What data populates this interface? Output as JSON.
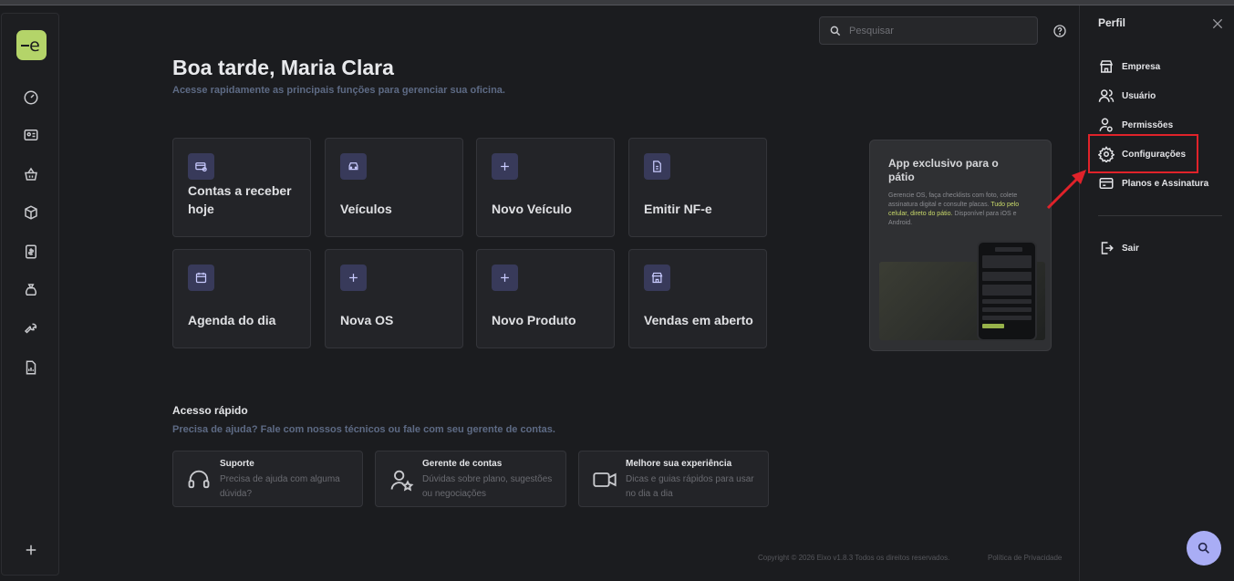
{
  "sidebar": {
    "logo_letter": "e",
    "items": [
      {
        "name": "dashboard-icon"
      },
      {
        "name": "id-card-icon"
      },
      {
        "name": "basket-icon"
      },
      {
        "name": "box-icon"
      },
      {
        "name": "receipt-icon"
      },
      {
        "name": "money-bag-icon"
      },
      {
        "name": "wrench-icon"
      },
      {
        "name": "report-icon"
      }
    ],
    "add_icon": "plus-icon"
  },
  "header": {
    "search_placeholder": "Pesquisar"
  },
  "home": {
    "greeting": "Boa tarde, Maria Clara",
    "subtitle": "Acesse rapidamente as principais funções para gerenciar sua oficina.",
    "cards": [
      {
        "label": "Contas a receber hoje",
        "icon": "money-card-icon"
      },
      {
        "label": "Veículos",
        "icon": "car-icon"
      },
      {
        "label": "Novo Veículo",
        "icon": "plus-icon"
      },
      {
        "label": "Emitir NF-e",
        "icon": "invoice-icon"
      },
      {
        "label": "Agenda do dia",
        "icon": "calendar-icon"
      },
      {
        "label": "Nova OS",
        "icon": "plus-icon"
      },
      {
        "label": "Novo Produto",
        "icon": "plus-icon"
      },
      {
        "label": "Vendas em aberto",
        "icon": "store-icon"
      }
    ],
    "promo": {
      "title": "App exclusivo para o pátio",
      "body_start": "Gerencie OS, faça checklists com foto, colete assinatura digital e consulte placas. ",
      "body_highlight": "Tudo pelo celular, direto do pátio.",
      "body_end": " Disponível para iOS e Android."
    },
    "quick_access": {
      "title": "Acesso rápido",
      "subtitle": "Precisa de ajuda? Fale com nossos técnicos ou fale com seu gerente de contas.",
      "items": [
        {
          "title": "Suporte",
          "desc": "Precisa de ajuda com alguma dúvida?",
          "icon": "headset-icon"
        },
        {
          "title": "Gerente de contas",
          "desc": "Dúvidas sobre plano, sugestões ou negociações",
          "icon": "user-star-icon"
        },
        {
          "title": "Melhore sua experiência",
          "desc": "Dicas e guias rápidos para usar no dia a dia",
          "icon": "video-icon"
        }
      ]
    },
    "footer": {
      "copyright": "Copyright © 2026 Eixo v1.8.3 Todos os direitos reservados.",
      "privacy": "Política de Privacidade"
    }
  },
  "profile_panel": {
    "title": "Perfil",
    "items": [
      {
        "label": "Empresa",
        "icon": "store-icon"
      },
      {
        "label": "Usuário",
        "icon": "users-icon"
      },
      {
        "label": "Permissões",
        "icon": "user-lock-icon"
      },
      {
        "label": "Configurações",
        "icon": "gear-icon"
      },
      {
        "label": "Planos e Assinatura",
        "icon": "credit-card-icon"
      }
    ],
    "logout": {
      "label": "Sair",
      "icon": "logout-icon"
    }
  },
  "colors": {
    "brand": "#b4d469",
    "accent": "#a9adf5",
    "highlight": "#e0222a"
  }
}
